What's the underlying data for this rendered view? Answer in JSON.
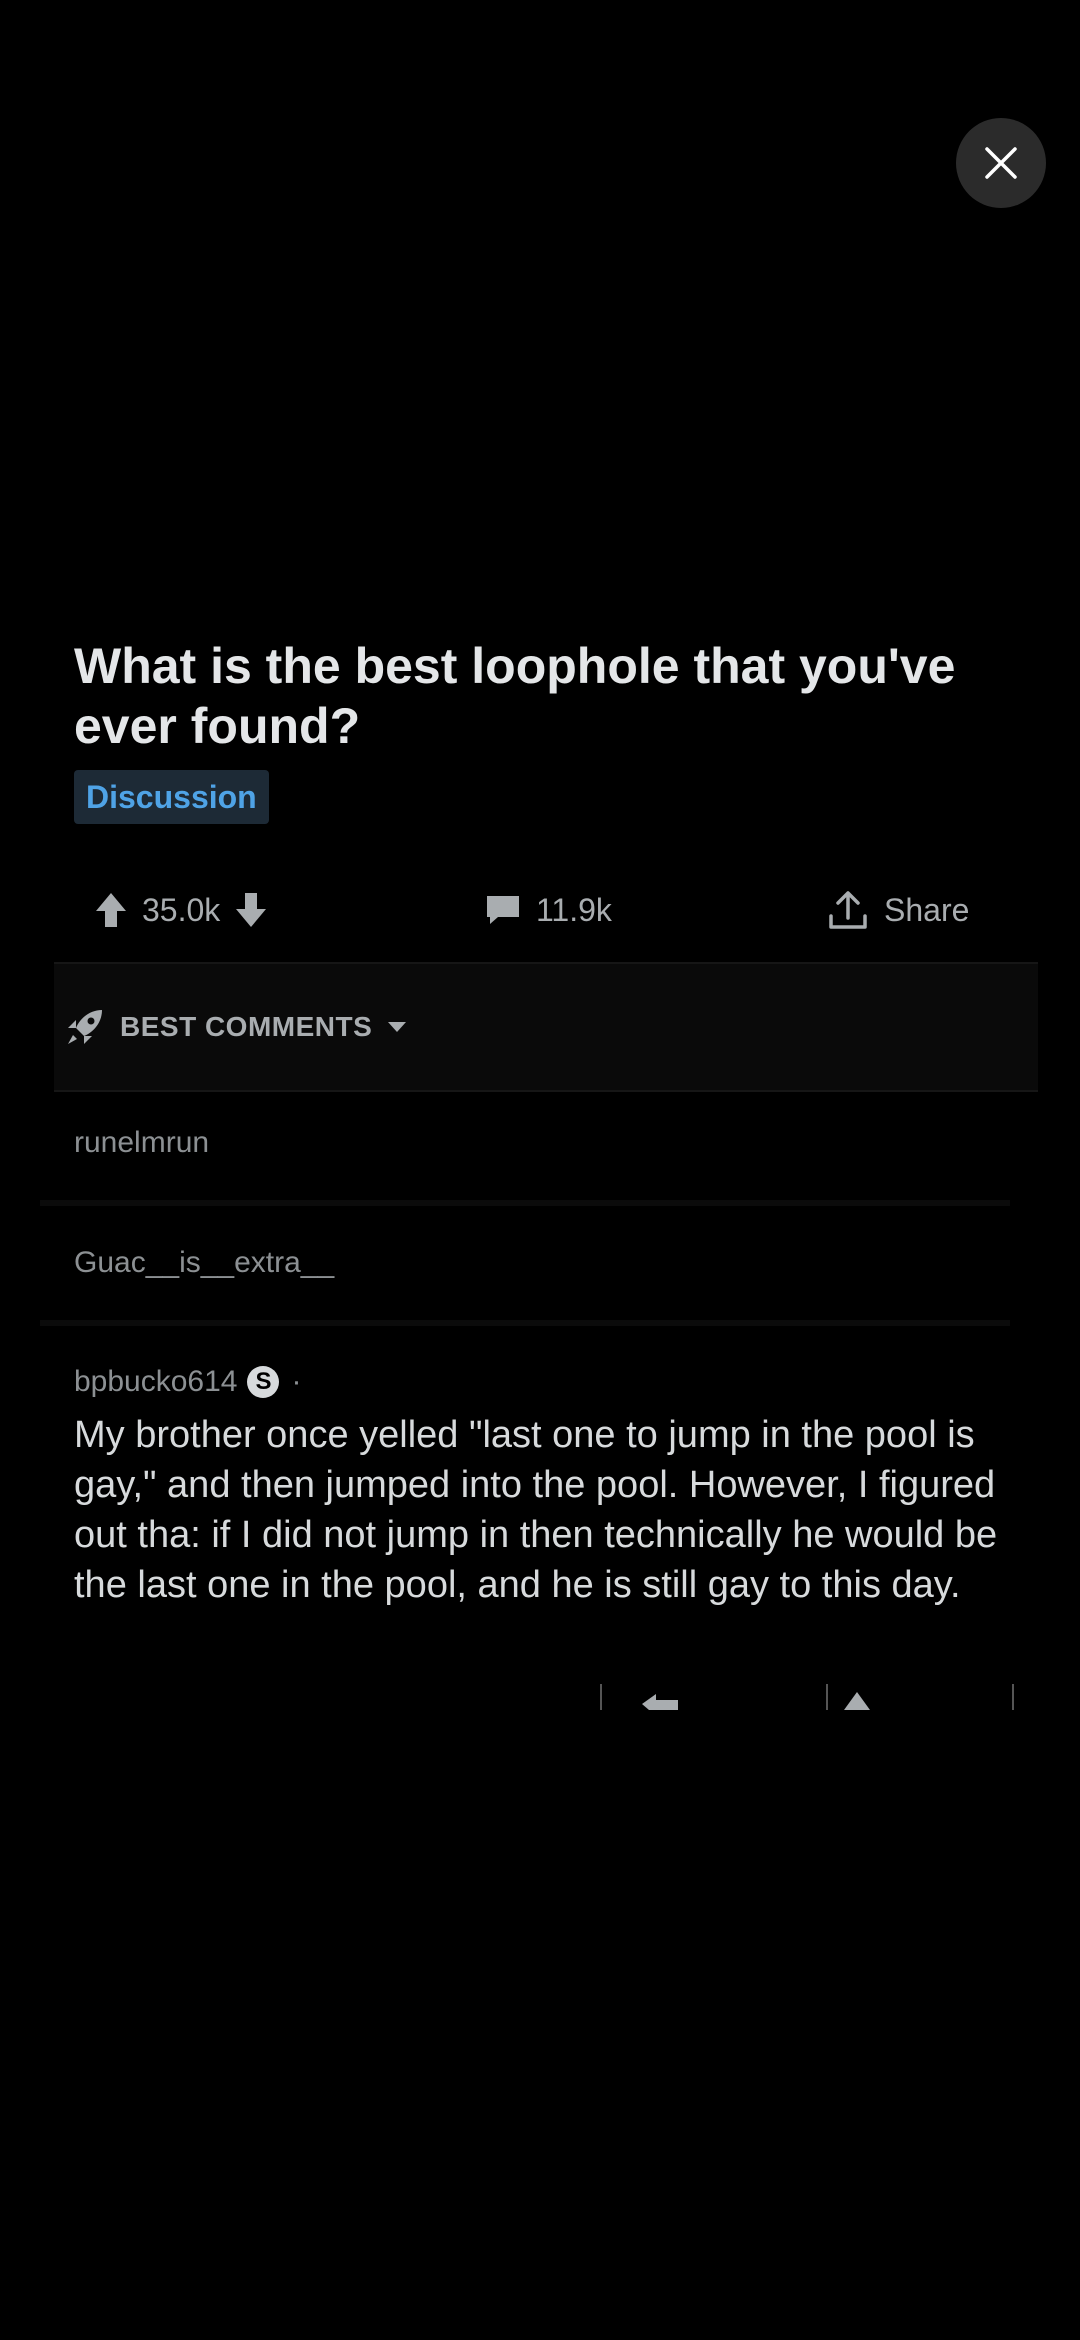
{
  "post": {
    "title": "What is the best loophole that you've ever found?",
    "flair": "Discussion",
    "votes": "35.0k",
    "comments": "11.9k",
    "share_label": "Share"
  },
  "sort": {
    "label": "BEST COMMENTS"
  },
  "collapsed_comments": [
    {
      "author": "runelmrun"
    },
    {
      "author": "Guac__is__extra__"
    }
  ],
  "comment": {
    "author": "bpbucko614",
    "badge": "S",
    "separator": "·",
    "body": "My brother once yelled \"last one to jump in the pool is gay,\" and then jumped into the pool. However, I figured out tha: if I did not jump in then technically he would be the last one in the pool, and he is still gay to this day."
  },
  "colors": {
    "background": "#000000",
    "flair_text": "#4fa3e6",
    "text_primary": "#d7dadc",
    "text_secondary": "#8c9093"
  }
}
